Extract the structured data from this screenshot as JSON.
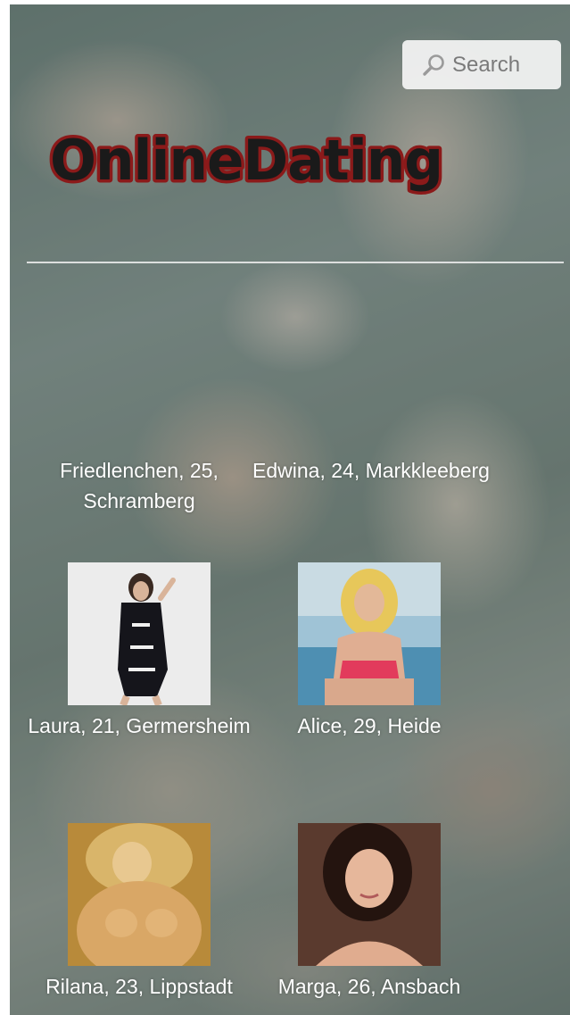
{
  "header": {
    "logo_text": "OnlineDating",
    "search": {
      "placeholder": "Search",
      "icon": "search-icon"
    }
  },
  "profiles": [
    {
      "caption": "Friedlenchen, 25, Schramberg",
      "has_photo": false
    },
    {
      "caption": "Edwina, 24, Markkleeberg",
      "has_photo": false
    },
    {
      "caption": "Laura, 21, Germersheim",
      "has_photo": true
    },
    {
      "caption": "Alice, 29, Heide",
      "has_photo": true
    },
    {
      "caption": "Rilana, 23, Lippstadt",
      "has_photo": true
    },
    {
      "caption": "Marga, 26, Ansbach",
      "has_photo": true
    }
  ],
  "colors": {
    "logo_fill": "#1a1a1a",
    "logo_outline": "#8b1a1a",
    "caption_text": "#ffffff"
  }
}
